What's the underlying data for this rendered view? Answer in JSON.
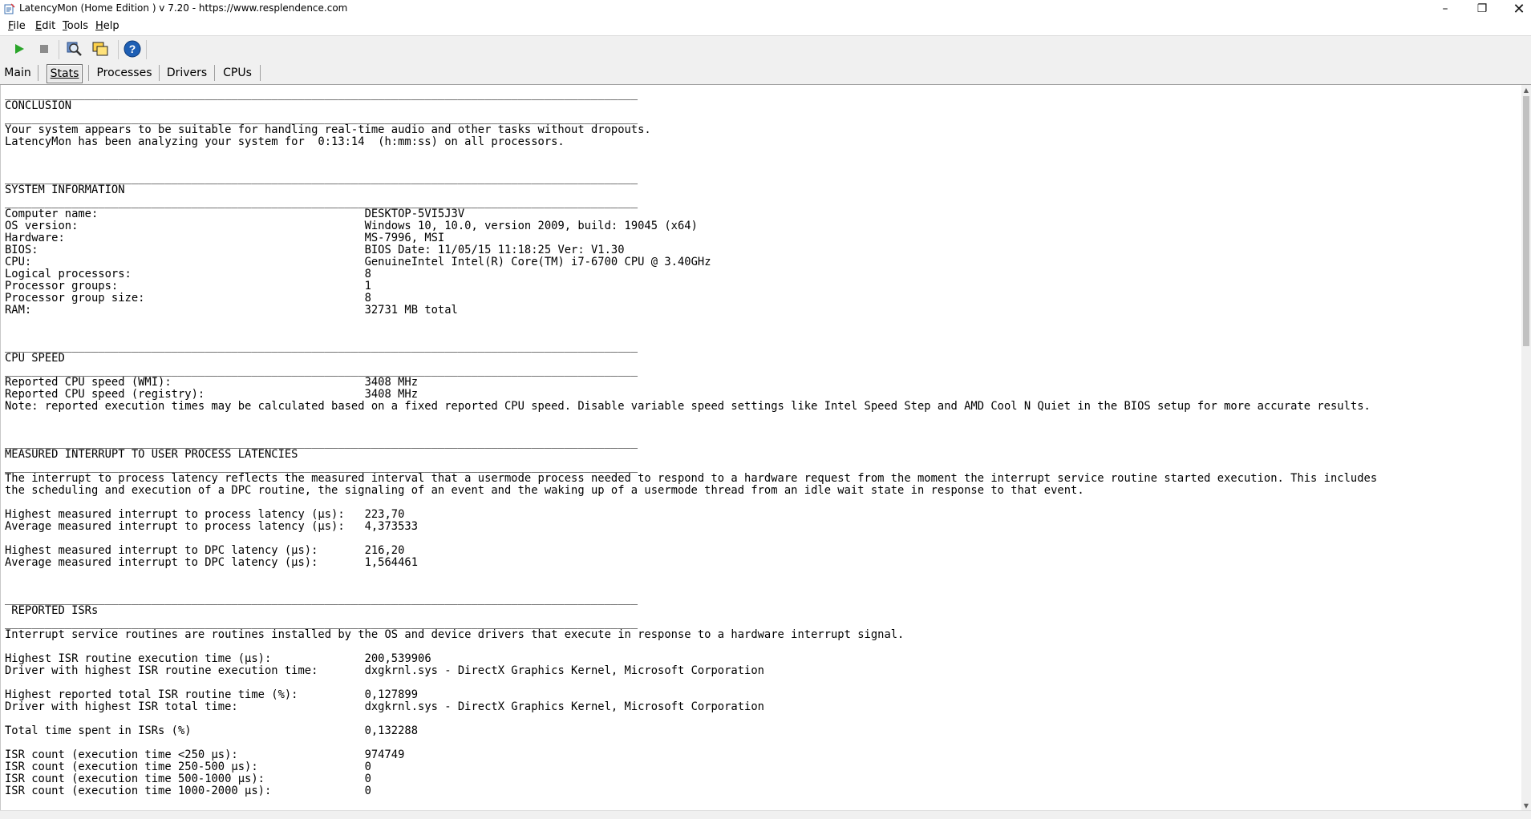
{
  "window": {
    "title": "LatencyMon  (Home Edition )  v 7.20 - https://www.resplendence.com",
    "minimize_glyph": "–",
    "maximize_glyph": "❐",
    "close_glyph": "✕"
  },
  "menu": {
    "file": {
      "acc": "F",
      "rest": "ile"
    },
    "edit": {
      "acc": "E",
      "rest": "dit"
    },
    "tools": {
      "acc": "T",
      "rest": "ools"
    },
    "help": {
      "acc": "H",
      "rest": "elp"
    }
  },
  "toolbar": {
    "icons": [
      "play-icon",
      "stop-icon",
      "driver-search-icon",
      "windows-icon",
      "help-icon"
    ],
    "accent": "#1e5fb4",
    "play_color": "#2aa52a"
  },
  "tabs": {
    "main": "Main",
    "stats": "Stats",
    "processes": "Processes",
    "drivers": "Drivers",
    "cpus": "CPUs",
    "selected": "stats"
  },
  "report": {
    "rule": "_______________________________________________________________________________________________",
    "conclusion": {
      "heading": "CONCLUSION",
      "line1": "Your system appears to be suitable for handling real-time audio and other tasks without dropouts.",
      "line2": "LatencyMon has been analyzing your system for  0:13:14  (h:mm:ss) on all processors."
    },
    "system_info": {
      "heading": "SYSTEM INFORMATION",
      "rows": [
        [
          "Computer name:",
          "DESKTOP-5VI5J3V"
        ],
        [
          "OS version:",
          "Windows 10, 10.0, version 2009, build: 19045 (x64)"
        ],
        [
          "Hardware:",
          "MS-7996, MSI"
        ],
        [
          "BIOS:",
          "BIOS Date: 11/05/15 11:18:25 Ver: V1.30"
        ],
        [
          "CPU:",
          "GenuineIntel Intel(R) Core(TM) i7-6700 CPU @ 3.40GHz"
        ],
        [
          "Logical processors:",
          "8"
        ],
        [
          "Processor groups:",
          "1"
        ],
        [
          "Processor group size:",
          "8"
        ],
        [
          "RAM:",
          "32731 MB total"
        ]
      ]
    },
    "cpu_speed": {
      "heading": "CPU SPEED",
      "rows": [
        [
          "Reported CPU speed (WMI):",
          "3408 MHz"
        ],
        [
          "Reported CPU speed (registry):",
          "3408 MHz"
        ]
      ],
      "note": "Note: reported execution times may be calculated based on a fixed reported CPU speed. Disable variable speed settings like Intel Speed Step and AMD Cool N Quiet in the BIOS setup for more accurate results."
    },
    "latencies": {
      "heading": "MEASURED INTERRUPT TO USER PROCESS LATENCIES",
      "desc1": "The interrupt to process latency reflects the measured interval that a usermode process needed to respond to a hardware request from the moment the interrupt service routine started execution. This includes",
      "desc2": "the scheduling and execution of a DPC routine, the signaling of an event and the waking up of a usermode thread from an idle wait state in response to that event.",
      "rows_a": [
        [
          "Highest measured interrupt to process latency (µs):",
          "223,70"
        ],
        [
          "Average measured interrupt to process latency (µs):",
          "4,373533"
        ]
      ],
      "rows_b": [
        [
          "Highest measured interrupt to DPC latency (µs):",
          "216,20"
        ],
        [
          "Average measured interrupt to DPC latency (µs):",
          "1,564461"
        ]
      ]
    },
    "isrs": {
      "heading": " REPORTED ISRs",
      "desc": "Interrupt service routines are routines installed by the OS and device drivers that execute in response to a hardware interrupt signal.",
      "rows_a": [
        [
          "Highest ISR routine execution time (µs):",
          "200,539906"
        ],
        [
          "Driver with highest ISR routine execution time:",
          "dxgkrnl.sys - DirectX Graphics Kernel, Microsoft Corporation"
        ]
      ],
      "rows_b": [
        [
          "Highest reported total ISR routine time (%):",
          "0,127899"
        ],
        [
          "Driver with highest ISR total time:",
          "dxgkrnl.sys - DirectX Graphics Kernel, Microsoft Corporation"
        ]
      ],
      "rows_c": [
        [
          "Total time spent in ISRs (%)",
          "0,132288"
        ]
      ],
      "rows_d": [
        [
          "ISR count (execution time <250 µs):",
          "974749"
        ],
        [
          "ISR count (execution time 250-500 µs):",
          "0"
        ],
        [
          "ISR count (execution time 500-1000 µs):",
          "0"
        ],
        [
          "ISR count (execution time 1000-2000 µs):",
          "0"
        ]
      ]
    }
  }
}
